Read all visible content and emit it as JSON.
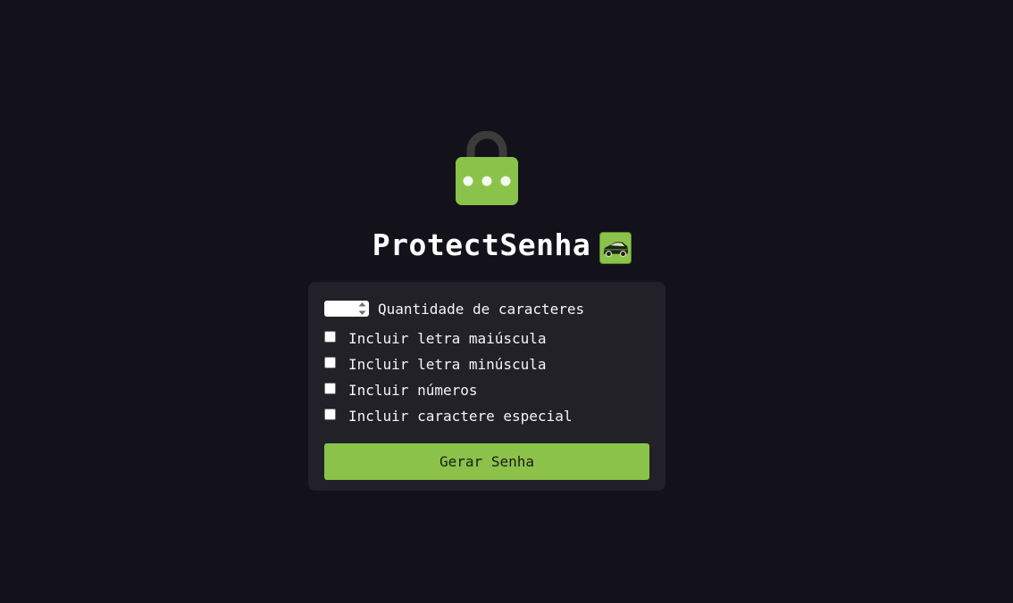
{
  "app": {
    "title": "ProtectSenha"
  },
  "icons": {
    "logo": "lock-icon",
    "title_badge": "car-icon"
  },
  "colors": {
    "background": "#13121a",
    "card": "#222128",
    "accent": "#8bc34a",
    "text": "#f2f2f2"
  },
  "form": {
    "length_label": "Quantidade de caracteres",
    "length_value": "",
    "options": [
      {
        "label": "Incluir letra maiúscula",
        "checked": false
      },
      {
        "label": "Incluir letra minúscula",
        "checked": false
      },
      {
        "label": "Incluir números",
        "checked": false
      },
      {
        "label": "Incluir caractere especial",
        "checked": false
      }
    ],
    "submit_label": "Gerar Senha"
  }
}
